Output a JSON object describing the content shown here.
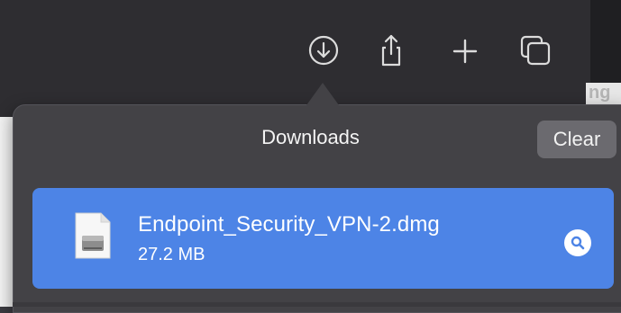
{
  "background": {
    "partial_text": "ng"
  },
  "toolbar": {
    "icons": [
      "download-icon",
      "share-icon",
      "plus-icon",
      "tabs-icon"
    ]
  },
  "downloads": {
    "title": "Downloads",
    "clear_label": "Clear",
    "items": [
      {
        "filename": "Endpoint_Security_VPN-2.dmg",
        "size": "27.2 MB",
        "file_icon": "disk-image-icon",
        "action_icon": "magnifier-icon"
      }
    ]
  },
  "colors": {
    "row_selected": "#4d84e6",
    "popover_bg": "#434246",
    "toolbar_bg": "#2e2d31"
  }
}
